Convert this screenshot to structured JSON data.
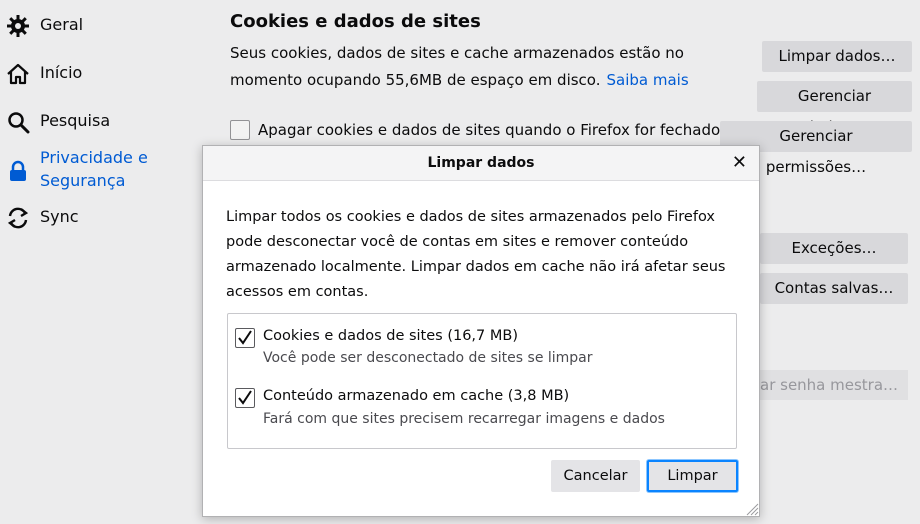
{
  "sidebar": {
    "items": [
      {
        "label": "Geral",
        "icon": "gear-icon"
      },
      {
        "label": "Início",
        "icon": "home-icon"
      },
      {
        "label": "Pesquisa",
        "icon": "search-icon"
      },
      {
        "label": "Privacidade e Segurança",
        "icon": "lock-icon",
        "active": true
      },
      {
        "label": "Sync",
        "icon": "sync-icon"
      }
    ]
  },
  "section": {
    "title": "Cookies e dados de sites",
    "desc_line1": "Seus cookies, dados de sites e cache armazenados estão no",
    "desc_line2": "momento ocupando 55,6MB de espaço em disco.",
    "learn_more": "Saiba mais",
    "delete_on_close": "Apagar cookies e dados de sites quando o Firefox for fechado"
  },
  "buttons": {
    "clear_data": "Limpar dados…",
    "manage_data": "Gerenciar dados…",
    "manage_perms": "Gerenciar permissões…",
    "exceptions": "Exceções…",
    "saved_accounts": "Contas salvas…",
    "master_password": "ar senha mestra…"
  },
  "dialog": {
    "title": "Limpar dados",
    "close_glyph": "✕",
    "body": "Limpar todos os cookies e dados de sites armazenados pelo Firefox pode desconectar você de contas em sites e remover conteúdo armazenado localmente. Limpar dados em cache não irá afetar seus acessos em contas.",
    "options": [
      {
        "label": "Cookies e dados de sites (16,7 MB)",
        "sub": "Você pode ser desconectado de sites se limpar",
        "checked": true
      },
      {
        "label": "Conteúdo armazenado em cache (3,8 MB)",
        "sub": "Fará com que sites precisem recarregar imagens e dados",
        "checked": true
      }
    ],
    "cancel": "Cancelar",
    "confirm": "Limpar"
  },
  "colors": {
    "accent": "#0060df",
    "focus": "#0a84ff",
    "button_bg": "#e4e4e7"
  }
}
